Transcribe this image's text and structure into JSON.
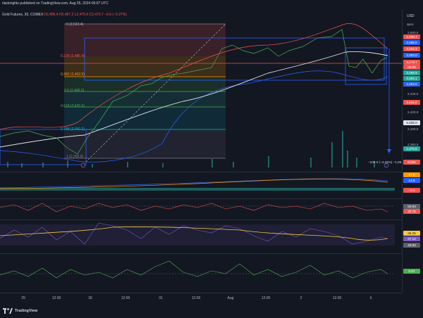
{
  "header": {
    "publisher_line": "rlacknights published on TradingView.com, Aug 05, 2024 06:07 UTC",
    "symbol": "Gold Futures, 30, COMEX",
    "ohlc": "O2,486.4 H2,487.2 L2,475.6 C2,479.7 −6.6 (−0.27%)",
    "ohlc_color": "#ef5350"
  },
  "axis": {
    "currency": "USD",
    "scale_mode": "apoc",
    "price_ticks": [
      "2,500.0",
      "2,485.0",
      "2,440.0",
      "2,420.0",
      "2,400.0",
      "2,380.0"
    ],
    "badges": [
      {
        "label": "2,486.7",
        "color": "#ef5350"
      },
      {
        "label": "2,485.0",
        "color": "#2962ff"
      },
      {
        "label": "2,482.2",
        "color": "#ef5350"
      },
      {
        "label": "2,483.0",
        "color": "#2962ff"
      },
      {
        "label": "2,479.7",
        "color": "#ef5350"
      },
      {
        "label": "02:09",
        "color": "#ef5350"
      },
      {
        "label": "2,466.9",
        "color": "#26a69a"
      },
      {
        "label": "2,463.1",
        "color": "#26a69a"
      },
      {
        "label": "2,453.5",
        "color": "#2962ff"
      },
      {
        "label": "2,431.0",
        "color": "#ef5350"
      },
      {
        "label": "2,406.0",
        "color": "#e0e3eb"
      },
      {
        "label": "2,376.8",
        "color": "#26a69a"
      },
      {
        "label": "8,696",
        "color": "#ef5350"
      }
    ]
  },
  "fib_levels": [
    {
      "label": "0 (2,523.4)",
      "color": "#b2b5be"
    },
    {
      "label": "0.236 (2,486.4)",
      "color": "#ef5350"
    },
    {
      "label": "0.382 (2,463.5)",
      "color": "#ff9800"
    },
    {
      "label": "0.5 (2,445.0)",
      "color": "#4caf50"
    },
    {
      "label": "0.618 (2,426.5)",
      "color": "#4caf50"
    },
    {
      "label": "0.786 (2,400.2)",
      "color": "#00bcd4"
    },
    {
      "label": "1 (2,366.8)",
      "color": "#787b86"
    }
  ],
  "measure_label": "−109.0 (−4.33%) −1,09...",
  "indicators": {
    "macd_values": [
      "17.6",
      "14.9",
      "−2.1"
    ],
    "macd_colors": [
      "#ff9800",
      "#2962ff",
      "#ef5350"
    ],
    "rsi_values": [
      "50.00",
      "33.78"
    ],
    "rsi_colors": [
      "#5d606b",
      "#ef5350"
    ],
    "stoch_values": [
      "48.25",
      "47.12",
      "40.00"
    ],
    "stoch_colors": [
      "#f5c842",
      "#7e57c2",
      "#5d606b"
    ],
    "osc_value": "0.07",
    "osc_color": "#4caf50"
  },
  "time_axis": [
    "29",
    "12:00",
    "30",
    "12:00",
    "31",
    "12:00",
    "Aug",
    "12:00",
    "2",
    "12:00",
    "5"
  ],
  "footer": {
    "brand": "TradingView"
  }
}
